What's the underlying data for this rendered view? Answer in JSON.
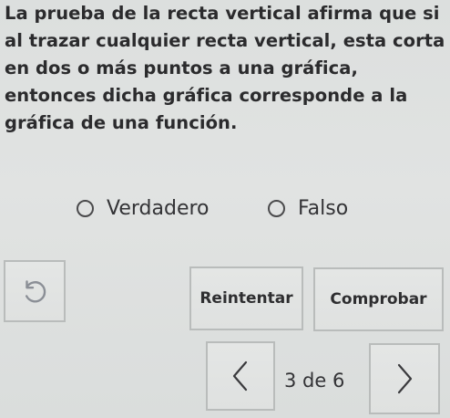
{
  "question": {
    "text": "La prueba de la recta vertical afirma que si al trazar cualquier recta vertical, esta corta en dos o más puntos a una gráfica, entonces dicha gráfica corresponde a la gráfica de una función."
  },
  "options": {
    "true_label": "Verdadero",
    "false_label": "Falso"
  },
  "buttons": {
    "reset_icon": "undo-icon",
    "retry_label": "Reintentar",
    "check_label": "Comprobar",
    "prev_icon": "chevron-left-icon",
    "next_icon": "chevron-right-icon"
  },
  "pagination": {
    "label": "3 de 6"
  }
}
